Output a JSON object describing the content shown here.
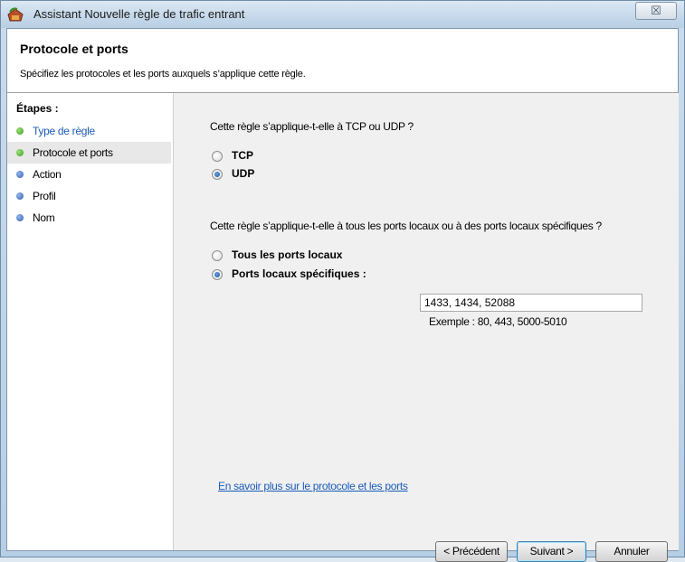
{
  "window": {
    "title": "Assistant Nouvelle règle de trafic entrant",
    "close_glyph": "☒"
  },
  "header": {
    "title": "Protocole et ports",
    "description": "Spécifiez les protocoles et les ports auxquels s’applique cette règle."
  },
  "steps": {
    "title": "Étapes :",
    "items": [
      {
        "label": "Type de règle",
        "status": "done"
      },
      {
        "label": "Protocole et ports",
        "status": "current"
      },
      {
        "label": "Action",
        "status": "pending"
      },
      {
        "label": "Profil",
        "status": "pending"
      },
      {
        "label": "Nom",
        "status": "pending"
      }
    ]
  },
  "protocol": {
    "question": "Cette règle s’applique-t-elle à TCP ou UDP ?",
    "tcp_label": "TCP",
    "udp_label": "UDP",
    "selected": "UDP"
  },
  "ports": {
    "question": "Cette règle s’applique-t-elle à tous les ports locaux ou à des ports locaux spécifiques ?",
    "all_label": "Tous les ports locaux",
    "specific_label": "Ports locaux spécifiques :",
    "selected": "specific",
    "value": "1433, 1434, 52088",
    "example": "Exemple : 80, 443, 5000-5010"
  },
  "help_link": "En savoir plus sur le protocole et les ports",
  "buttons": {
    "back": "< Précédent",
    "next": "Suivant >",
    "cancel": "Annuler"
  },
  "colors": {
    "link": "#1a5bb8",
    "done_dot": "#3c9a1e",
    "pending_dot": "#2f5fb0"
  }
}
